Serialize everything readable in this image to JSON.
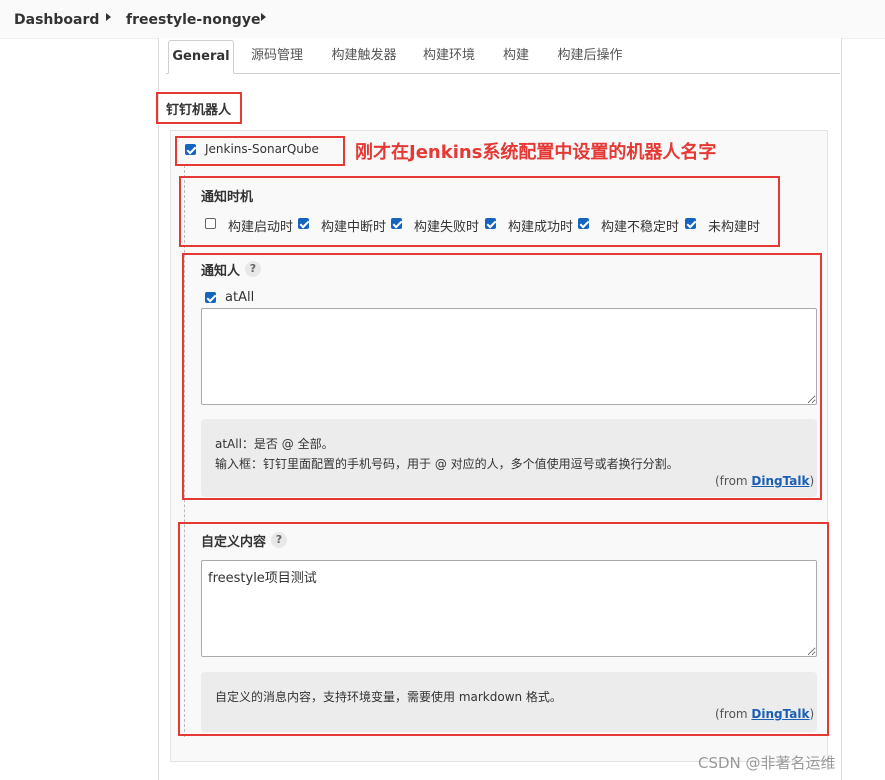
{
  "breadcrumb": {
    "root": "Dashboard",
    "job": "freestyle-nongye"
  },
  "tabs": [
    "General",
    "源码管理",
    "构建触发器",
    "构建环境",
    "构建",
    "构建后操作"
  ],
  "section": {
    "title": "钉钉机器人"
  },
  "robot": {
    "name": "Jenkins-SonarQube",
    "checked": true
  },
  "annotation": "刚才在Jenkins系统配置中设置的机器人名字",
  "notify_timing": {
    "title": "通知时机",
    "options": [
      {
        "label": "构建启动时",
        "checked": false
      },
      {
        "label": "构建中断时",
        "checked": true
      },
      {
        "label": "构建失败时",
        "checked": true
      },
      {
        "label": "构建成功时",
        "checked": true
      },
      {
        "label": "构建不稳定时",
        "checked": true
      },
      {
        "label": "未构建时",
        "checked": true
      }
    ]
  },
  "notify_people": {
    "title": "通知人",
    "help": "?",
    "atall_label": "atAll",
    "atall_checked": true,
    "textarea_value": "",
    "help_line1": "atAll：是否 @ 全部。",
    "help_line2": "输入框：钉钉里面配置的手机号码，用于 @ 对应的人，多个值使用逗号或者换行分割。",
    "from_prefix": "(from ",
    "from_link": "DingTalk",
    "from_suffix": ")"
  },
  "custom_content": {
    "title": "自定义内容",
    "help": "?",
    "textarea_value": "freestyle项目测试",
    "help_text": "自定义的消息内容，支持环境变量，需要使用 markdown 格式。",
    "from_prefix": "(from ",
    "from_link": "DingTalk",
    "from_suffix": ")"
  },
  "watermark": "CSDN @非著名运维",
  "colors": {
    "annotation_red": "#e53935",
    "checkbox_blue": "#1565c0",
    "link_blue": "#1a5fb4"
  }
}
